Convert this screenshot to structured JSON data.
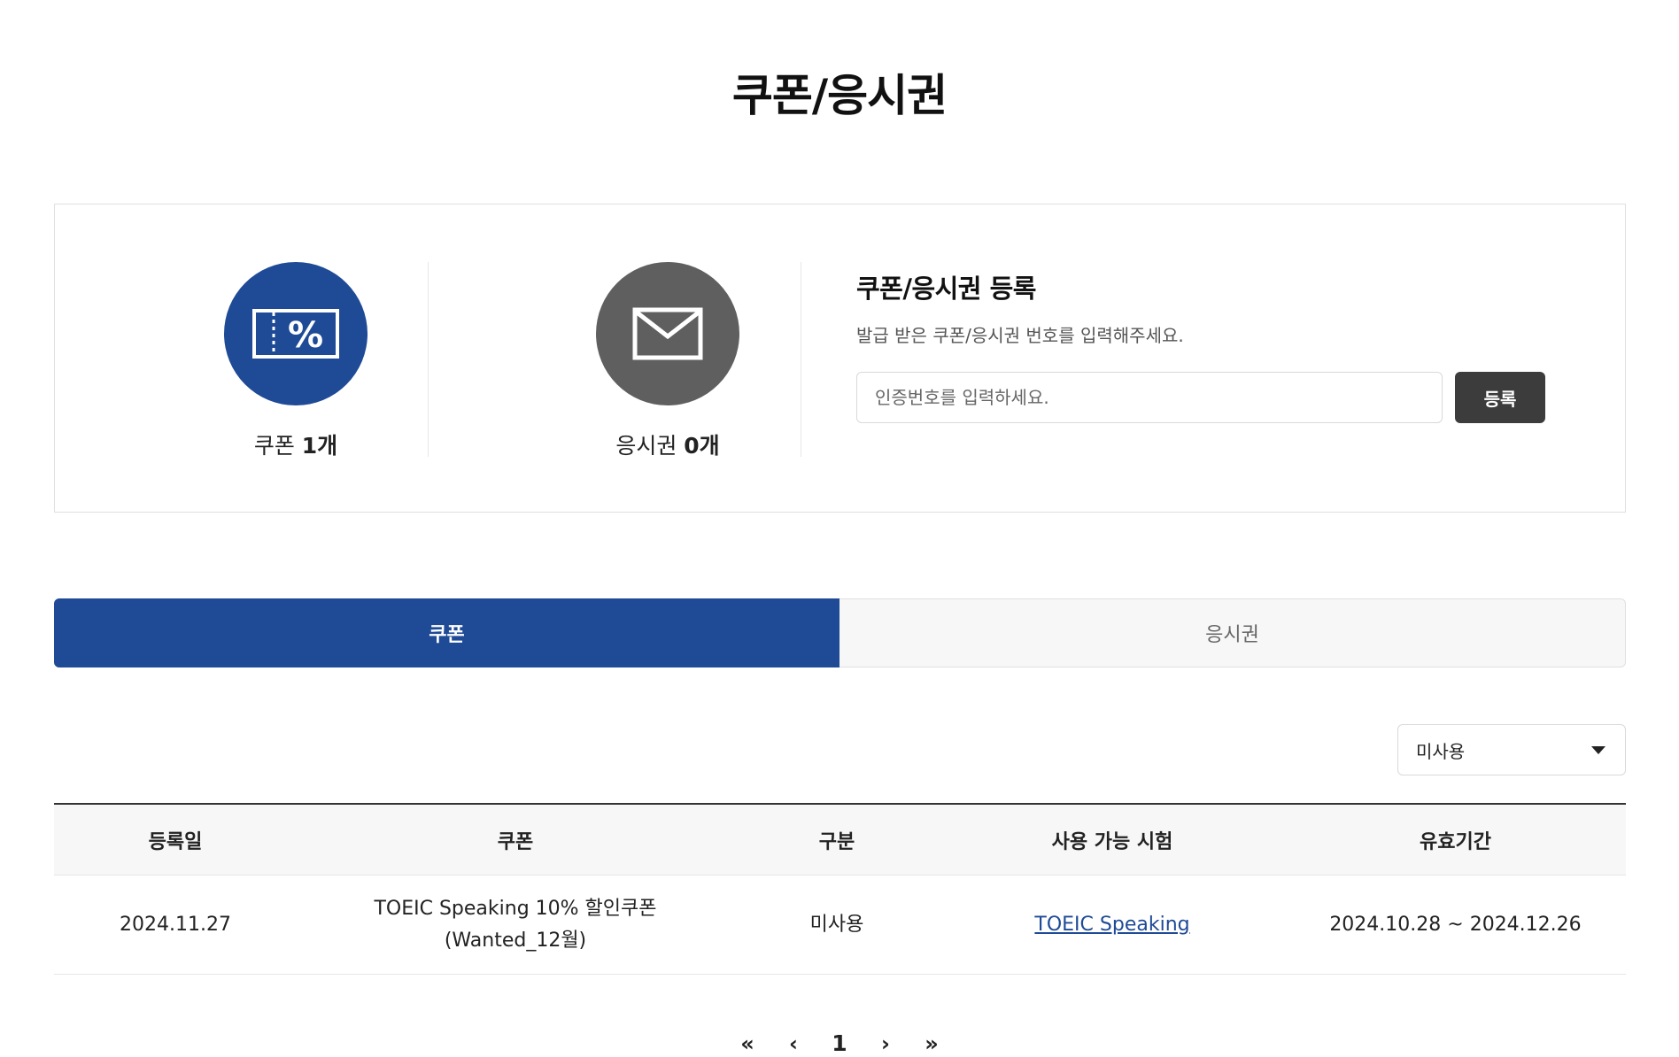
{
  "header": {
    "title": "쿠폰/응시권"
  },
  "summary": {
    "coupon": {
      "label": "쿠폰",
      "count": "1개",
      "icon": "coupon-percent-icon",
      "color": "#1e4a96"
    },
    "ticket": {
      "label": "응시권",
      "count": "0개",
      "icon": "envelope-icon",
      "color": "#5f5f5f"
    }
  },
  "register": {
    "title": "쿠폰/응시권 등록",
    "description": "발급 받은 쿠폰/응시권 번호를 입력해주세요.",
    "input_placeholder": "인증번호를 입력하세요.",
    "input_value": "",
    "button_label": "등록"
  },
  "tabs": [
    {
      "label": "쿠폰",
      "active": true
    },
    {
      "label": "응시권",
      "active": false
    }
  ],
  "filter": {
    "selected": "미사용",
    "icon": "caret-down-icon"
  },
  "table": {
    "headers": [
      "등록일",
      "쿠폰",
      "구분",
      "사용 가능 시험",
      "유효기간"
    ],
    "rows": [
      {
        "registered": "2024.11.27",
        "coupon_line1": "TOEIC Speaking 10% 할인쿠폰",
        "coupon_line2": "(Wanted_12월)",
        "status": "미사용",
        "exam": "TOEIC Speaking",
        "validity": "2024.10.28 ~ 2024.12.26"
      }
    ]
  },
  "pagination": {
    "first": "«",
    "prev": "‹",
    "current": "1",
    "next": "›",
    "last": "»"
  },
  "colors": {
    "accent": "#1e4a96",
    "dark_button": "#3c3c3c"
  }
}
